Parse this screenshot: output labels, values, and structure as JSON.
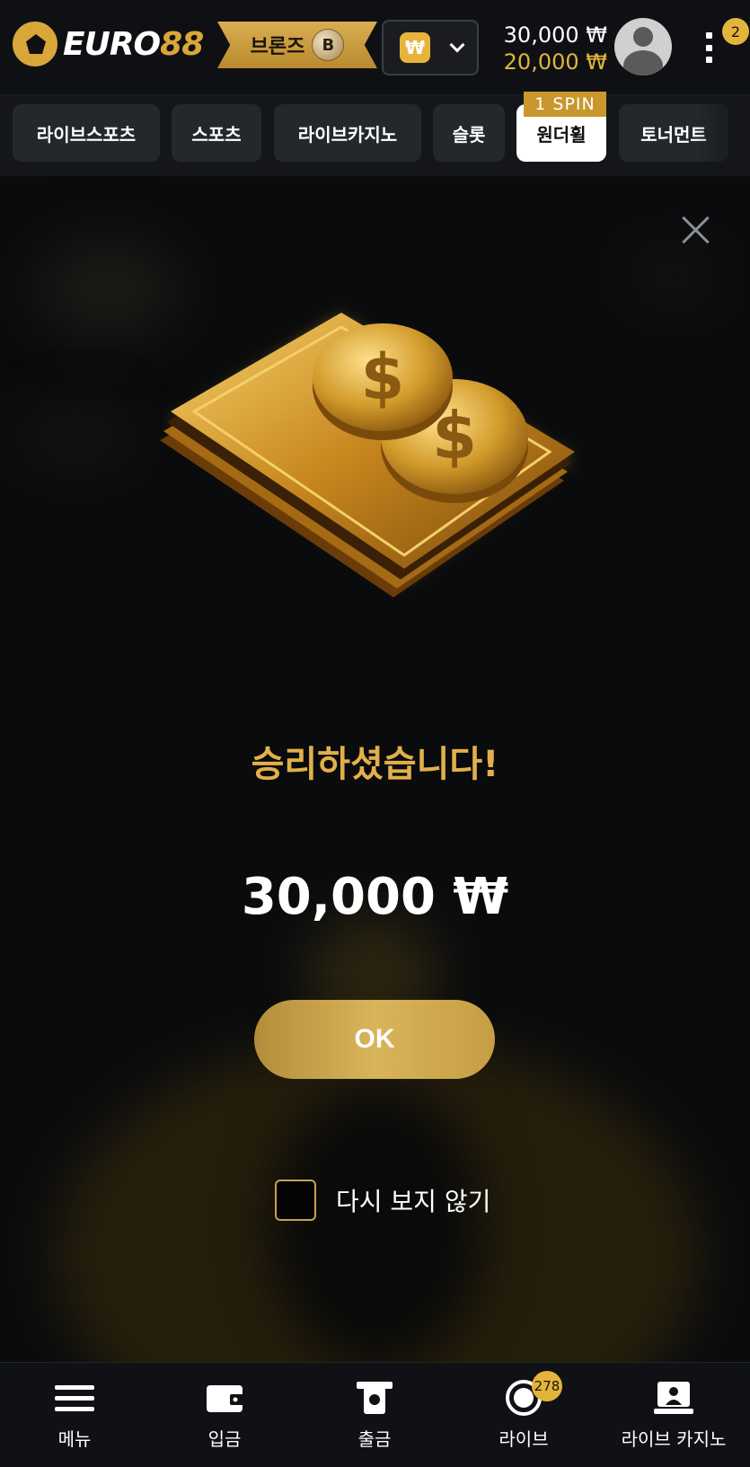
{
  "header": {
    "logo_white": "EURO",
    "logo_gold": "88",
    "rank_label": "브론즈",
    "rank_badge": "B",
    "currency_symbol": "₩",
    "balance_main": "30,000 ₩",
    "balance_bonus": "20,000 ₩",
    "notification_count": "2"
  },
  "tabs": [
    {
      "label": "라이브스포츠"
    },
    {
      "label": "스포츠"
    },
    {
      "label": "라이브카지노"
    },
    {
      "label": "슬롯"
    },
    {
      "label": "원더휠",
      "tag": "1 SPIN",
      "active": true
    },
    {
      "label": "토너먼트"
    }
  ],
  "modal": {
    "title": "승리하셨습니다!",
    "amount": "30,000 ₩",
    "ok_label": "OK",
    "dont_show_label": "다시 보지 않기",
    "coin_symbol": "$"
  },
  "bottom_nav": {
    "items": [
      {
        "label": "메뉴",
        "icon": "hamburger-icon"
      },
      {
        "label": "입금",
        "icon": "wallet-icon"
      },
      {
        "label": "출금",
        "icon": "withdraw-icon"
      },
      {
        "label": "라이브",
        "icon": "live-icon",
        "badge": "278"
      },
      {
        "label": "라이브 카지노",
        "icon": "live-casino-icon"
      }
    ]
  },
  "colors": {
    "accent_gold": "#e2b43c",
    "title_gold": "#e2b04a",
    "background": "#0b0c0e"
  }
}
